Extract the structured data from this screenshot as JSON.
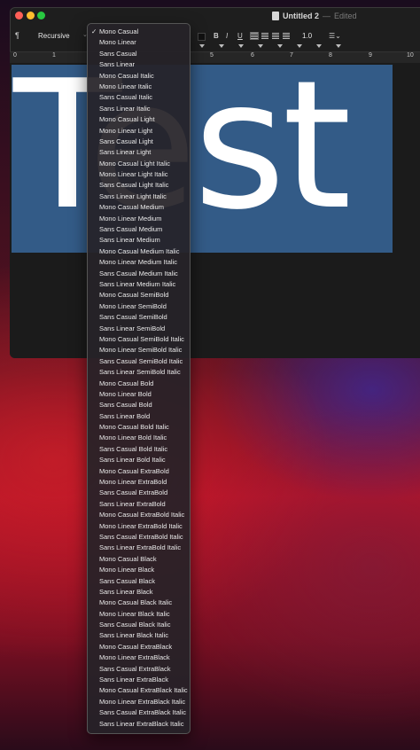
{
  "window": {
    "title": "Untitled 2",
    "title_separator": "—",
    "status": "Edited"
  },
  "toolbar": {
    "paragraph_icon": "¶",
    "font_name": "Recursive",
    "bold": "B",
    "italic": "I",
    "underline": "U",
    "line_spacing": "1.0"
  },
  "ruler": {
    "labels": [
      "0",
      "1",
      "5",
      "6",
      "7",
      "8",
      "9",
      "10"
    ]
  },
  "document": {
    "text": "Test",
    "highlight_color": "#335b87",
    "text_color": "#ffffff"
  },
  "font_menu": {
    "checkmark": "✓",
    "selected": "Mono Casual",
    "items": [
      "Mono Casual",
      "Mono Linear",
      "Sans Casual",
      "Sans Linear",
      "Mono Casual Italic",
      "Mono Linear Italic",
      "Sans Casual Italic",
      "Sans Linear Italic",
      "Mono Casual Light",
      "Mono Linear Light",
      "Sans Casual Light",
      "Sans Linear Light",
      "Mono Casual Light Italic",
      "Mono Linear Light Italic",
      "Sans Casual Light Italic",
      "Sans Linear Light Italic",
      "Mono Casual Medium",
      "Mono Linear Medium",
      "Sans Casual Medium",
      "Sans Linear Medium",
      "Mono Casual Medium Italic",
      "Mono Linear Medium Italic",
      "Sans Casual Medium Italic",
      "Sans Linear Medium Italic",
      "Mono Casual SemiBold",
      "Mono Linear SemiBold",
      "Sans Casual SemiBold",
      "Sans Linear SemiBold",
      "Mono Casual SemiBold Italic",
      "Mono Linear SemiBold Italic",
      "Sans Casual SemiBold Italic",
      "Sans Linear SemiBold Italic",
      "Mono Casual Bold",
      "Mono Linear Bold",
      "Sans Casual Bold",
      "Sans Linear Bold",
      "Mono Casual Bold Italic",
      "Mono Linear Bold Italic",
      "Sans Casual Bold Italic",
      "Sans Linear Bold Italic",
      "Mono Casual ExtraBold",
      "Mono Linear ExtraBold",
      "Sans Casual ExtraBold",
      "Sans Linear ExtraBold",
      "Mono Casual ExtraBold Italic",
      "Mono Linear ExtraBold Italic",
      "Sans Casual ExtraBold Italic",
      "Sans Linear ExtraBold Italic",
      "Mono Casual Black",
      "Mono Linear Black",
      "Sans Casual Black",
      "Sans Linear Black",
      "Mono Casual Black Italic",
      "Mono Linear Black Italic",
      "Sans Casual Black Italic",
      "Sans Linear Black Italic",
      "Mono Casual ExtraBlack",
      "Mono Linear ExtraBlack",
      "Sans Casual ExtraBlack",
      "Sans Linear ExtraBlack",
      "Mono Casual ExtraBlack Italic",
      "Mono Linear ExtraBlack Italic",
      "Sans Casual ExtraBlack Italic",
      "Sans Linear ExtraBlack Italic"
    ]
  },
  "colors": {
    "close": "#ff5f57",
    "minimize": "#febc2e",
    "maximize": "#28c840"
  }
}
